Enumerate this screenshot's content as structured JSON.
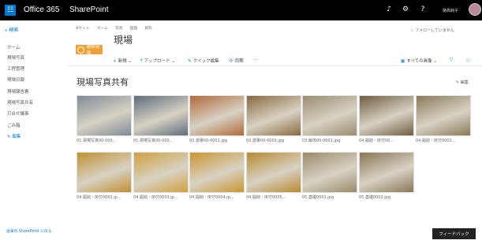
{
  "topbar": {
    "app": "Office 365",
    "site": "SharePoint",
    "user": "樋高純子"
  },
  "nav": {
    "search": "検索",
    "items": [
      "ホーム",
      "現場写真",
      "工程管理",
      "現場日報",
      "現場報告書",
      "現場写真共有",
      "打合せ議事",
      "ごみ箱"
    ],
    "edit": "編集",
    "classic": "従来の SharePoint に戻る"
  },
  "breadcrumb": [
    "Aサイト",
    "ホーム",
    "写真",
    "図面",
    "資料"
  ],
  "site": {
    "title": "現場",
    "logo": "建設現場",
    "follow": "フォローしていません"
  },
  "cmdbar": {
    "new": "新規",
    "upload": "アップロード",
    "quickedit": "クイック編集",
    "sync": "同期",
    "more": "⋯",
    "views": "すべての画像"
  },
  "library": {
    "title": "現場写真共有",
    "edit": "編集"
  },
  "photos": [
    {
      "caption": "01.現場写真00-000...",
      "color": "#7f8a96"
    },
    {
      "caption": "01.現場写真00-000...",
      "color": "#5e6c7c"
    },
    {
      "caption": "02.測量00-0001.jpg",
      "color": "#b06a3a"
    },
    {
      "caption": "02.測量00-0002.jpg",
      "color": "#8a6a3c"
    },
    {
      "caption": "03.解体00-0001.jpg",
      "color": "#9a8c70"
    },
    {
      "caption": "04.掘削・床付00...",
      "color": "#6f5c40"
    },
    {
      "caption": "04.掘削・床付0001...",
      "color": "#8a7a5a"
    },
    {
      "caption": "04.掘削・床付0002.jp...",
      "color": "#c09030"
    },
    {
      "caption": "04.掘削・床付0003.jp...",
      "color": "#d0a040"
    },
    {
      "caption": "04.掘削・床付0004.jp...",
      "color": "#c8962e"
    },
    {
      "caption": "04.掘削・床付0005...",
      "color": "#b88a30"
    },
    {
      "caption": "05.基礎0001.jpg",
      "color": "#9a8a6a"
    },
    {
      "caption": "05.基礎0002.jpg",
      "color": "#8a7656"
    }
  ],
  "feedback": "フィードバック"
}
